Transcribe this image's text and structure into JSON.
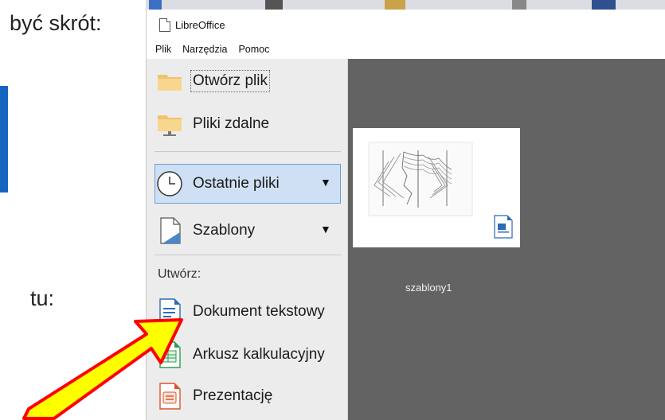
{
  "slide": {
    "text_top": "być skrót:",
    "text_mid": "tu:"
  },
  "window": {
    "title": "LibreOffice",
    "menu": [
      "Plik",
      "Narzędzia",
      "Pomoc"
    ]
  },
  "sidebar": {
    "open_file": "Otwórz plik",
    "remote_files": "Pliki zdalne",
    "recent_files": "Ostatnie pliki",
    "templates": "Szablony",
    "create_heading": "Utwórz:",
    "text_document": "Dokument tekstowy",
    "spreadsheet": "Arkusz kalkulacyjny",
    "presentation": "Prezentację"
  },
  "content": {
    "thumbnail_label": "szablony1"
  },
  "colors": {
    "arrow_fill": "#ffff00",
    "arrow_stroke": "#ff0000",
    "selected_bg": "#cfe0f5",
    "content_bg": "#636363"
  }
}
